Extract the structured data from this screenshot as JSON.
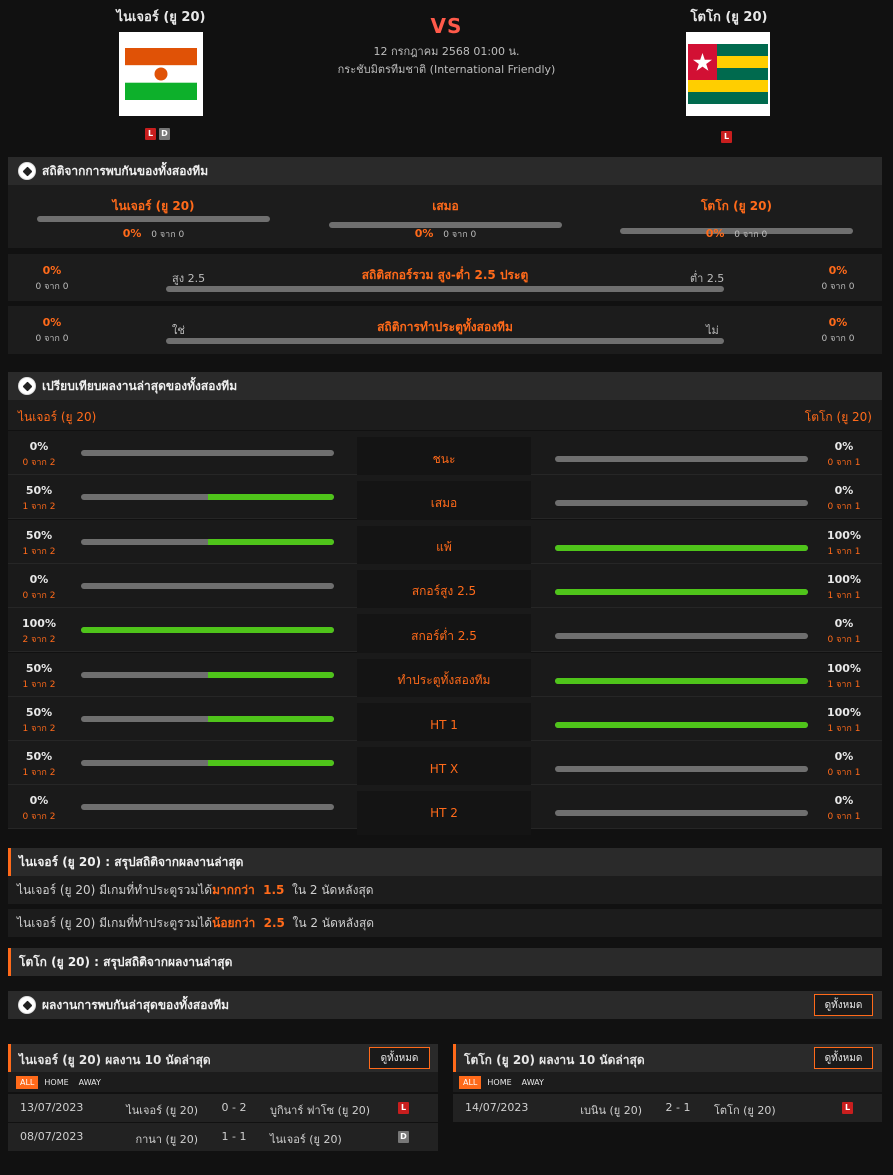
{
  "match": {
    "home": "ไนเจอร์ (ยู 20)",
    "away": "โตโก (ยู 20)",
    "vs": "VS",
    "datetime": "12 กรกฎาคม 2568 01:00 น.",
    "competition": "กระชับมิตรทีมชาติ (International Friendly)",
    "home_form": [
      "L",
      "D"
    ],
    "away_form": [
      "L"
    ]
  },
  "h2h": {
    "title": "สถิติจากการพบกันของทั้งสองทีม",
    "home_label": "ไนเจอร์ (ยู 20)",
    "draw_label": "เสมอ",
    "away_label": "โตโก (ยู 20)",
    "home_pct": "0%",
    "home_sub": "0 จาก 0",
    "draw_pct": "0%",
    "draw_sub": "0 จาก 0",
    "away_pct": "0%",
    "away_sub": "0 จาก 0",
    "ou_title": "สถิติสกอร์รวม สูง-ต่ำ 2.5 ประตู",
    "ou_left_label": "สูง 2.5",
    "ou_right_label": "ต่ำ 2.5",
    "ou_left_pct": "0%",
    "ou_left_sub": "0 จาก 0",
    "ou_right_pct": "0%",
    "ou_right_sub": "0 จาก 0",
    "btts_title": "สถิติการทำประตูทั้งสองทีม",
    "btts_left_label": "ใช่",
    "btts_right_label": "ไม่",
    "btts_left_pct": "0%",
    "btts_left_sub": "0 จาก 0",
    "btts_right_pct": "0%",
    "btts_right_sub": "0 จาก 0"
  },
  "compare": {
    "title": "เปรียบเทียบผลงานล่าสุดของทั้งสองทีม",
    "home_label": "ไนเจอร์ (ยู 20)",
    "away_label": "โตโก (ยู 20)",
    "rows": [
      {
        "label": "ชนะ",
        "home_pct": "0%",
        "home_sub": "0 จาก 2",
        "home_fill": 0,
        "away_pct": "0%",
        "away_sub": "0 จาก 1",
        "away_fill": 0
      },
      {
        "label": "เสมอ",
        "home_pct": "50%",
        "home_sub": "1 จาก 2",
        "home_fill": 0.5,
        "away_pct": "0%",
        "away_sub": "0 จาก 1",
        "away_fill": 0
      },
      {
        "label": "แพ้",
        "home_pct": "50%",
        "home_sub": "1 จาก 2",
        "home_fill": 0.5,
        "away_pct": "100%",
        "away_sub": "1 จาก 1",
        "away_fill": 1
      },
      {
        "label": "สกอร์สูง 2.5",
        "home_pct": "0%",
        "home_sub": "0 จาก 2",
        "home_fill": 0,
        "away_pct": "100%",
        "away_sub": "1 จาก 1",
        "away_fill": 1
      },
      {
        "label": "สกอร์ต่ำ 2.5",
        "home_pct": "100%",
        "home_sub": "2 จาก 2",
        "home_fill": 1,
        "away_pct": "0%",
        "away_sub": "0 จาก 1",
        "away_fill": 0
      },
      {
        "label": "ทำประตูทั้งสองทีม",
        "home_pct": "50%",
        "home_sub": "1 จาก 2",
        "home_fill": 0.5,
        "away_pct": "100%",
        "away_sub": "1 จาก 1",
        "away_fill": 1
      },
      {
        "label": "HT 1",
        "home_pct": "50%",
        "home_sub": "1 จาก 2",
        "home_fill": 0.5,
        "away_pct": "100%",
        "away_sub": "1 จาก 1",
        "away_fill": 1
      },
      {
        "label": "HT X",
        "home_pct": "50%",
        "home_sub": "1 จาก 2",
        "home_fill": 0.5,
        "away_pct": "0%",
        "away_sub": "0 จาก 1",
        "away_fill": 0
      },
      {
        "label": "HT 2",
        "home_pct": "0%",
        "home_sub": "0 จาก 2",
        "home_fill": 0,
        "away_pct": "0%",
        "away_sub": "0 จาก 1",
        "away_fill": 0
      }
    ]
  },
  "summary_home": {
    "title": "ไนเจอร์ (ยู 20) : สรุปสถิติจากผลงานล่าสุด",
    "line1": {
      "a": "ไนเจอร์ (ยู 20)  มีเกมที่ทำประตูรวมได้ ",
      "b": "มากกว่า  1.5",
      "c": "  ใน 2 นัดหลังสุด"
    },
    "line2": {
      "a": "ไนเจอร์ (ยู 20)  มีเกมที่ทำประตูรวมได้ ",
      "b": "น้อยกว่า  2.5",
      "c": "  ใน 2 นัดหลังสุด"
    }
  },
  "summary_away": {
    "title": "โตโก (ยู 20) : สรุปสถิติจากผลงานล่าสุด"
  },
  "recent_h2h": {
    "title": "ผลงานการพบกันล่าสุดของทั้งสองทีม",
    "view_all": "ดูทั้งหมด"
  },
  "last10_home": {
    "title": "ไนเจอร์ (ยู 20) ผลงาน 10 นัดล่าสุด",
    "view_all": "ดูทั้งหมด",
    "tabs": [
      "ALL",
      "HOME",
      "AWAY"
    ],
    "rows": [
      {
        "date": "13/07/2023",
        "home": "ไนเจอร์ (ยู 20)",
        "score": "0 - 2",
        "away": "บูกินาร์ ฟาโซ (ยู 20)",
        "result": "L"
      },
      {
        "date": "08/07/2023",
        "home": "กานา (ยู 20)",
        "score": "1 - 1",
        "away": "ไนเจอร์ (ยู 20)",
        "result": "D"
      }
    ]
  },
  "last10_away": {
    "title": "โตโก (ยู 20) ผลงาน 10 นัดล่าสุด",
    "view_all": "ดูทั้งหมด",
    "tabs": [
      "ALL",
      "HOME",
      "AWAY"
    ],
    "rows": [
      {
        "date": "14/07/2023",
        "home": "เบนิน (ยู 20)",
        "score": "2 - 1",
        "away": "โตโก (ยู 20)",
        "result": "L"
      }
    ]
  },
  "colors": {
    "accent": "#ff6a1a",
    "win_bar": "#4fc41a",
    "loss_badge": "#c81e1e",
    "draw_badge": "#777777",
    "vs": "#ff5a4a"
  }
}
